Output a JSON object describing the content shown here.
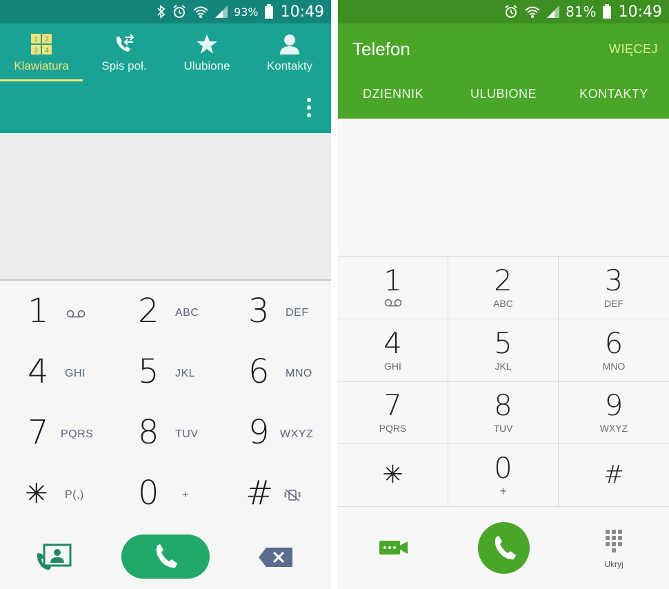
{
  "left": {
    "status": {
      "battery": "93%",
      "time": "10:49"
    },
    "tabs": [
      {
        "label": "Klawiatura",
        "icon": "keypad-grid-icon",
        "active": true
      },
      {
        "label": "Spis poł.",
        "icon": "call-log-icon"
      },
      {
        "label": "Ulubione",
        "icon": "star-icon"
      },
      {
        "label": "Kontakty",
        "icon": "person-icon"
      }
    ],
    "keys": [
      {
        "digit": "1",
        "sub": "ꝏ"
      },
      {
        "digit": "2",
        "sub": "ABC"
      },
      {
        "digit": "3",
        "sub": "DEF"
      },
      {
        "digit": "4",
        "sub": "GHI"
      },
      {
        "digit": "5",
        "sub": "JKL"
      },
      {
        "digit": "6",
        "sub": "MNO"
      },
      {
        "digit": "7",
        "sub": "PQRS"
      },
      {
        "digit": "8",
        "sub": "TUV"
      },
      {
        "digit": "9",
        "sub": "WXYZ"
      },
      {
        "digit": "✳",
        "sub": "P(,)"
      },
      {
        "digit": "0",
        "sub": "+"
      },
      {
        "digit": "#",
        "sub": ""
      }
    ],
    "colors": {
      "header": "#1aa393",
      "status": "#13857a",
      "active_tab": "#f7e27a",
      "call": "#22a86a"
    }
  },
  "right": {
    "status": {
      "battery": "81%",
      "time": "10:49"
    },
    "title": "Telefon",
    "more": "WIĘCEJ",
    "tabs": [
      "DZIENNIK",
      "ULUBIONE",
      "KONTAKTY"
    ],
    "keys": [
      {
        "digit": "1",
        "sub": "ꝏ"
      },
      {
        "digit": "2",
        "sub": "ABC"
      },
      {
        "digit": "3",
        "sub": "DEF"
      },
      {
        "digit": "4",
        "sub": "GHI"
      },
      {
        "digit": "5",
        "sub": "JKL"
      },
      {
        "digit": "6",
        "sub": "MNO"
      },
      {
        "digit": "7",
        "sub": "PQRS"
      },
      {
        "digit": "8",
        "sub": "TUV"
      },
      {
        "digit": "9",
        "sub": "WXYZ"
      },
      {
        "digit": "✳",
        "sub": ""
      },
      {
        "digit": "0",
        "sub": "+"
      },
      {
        "digit": "#",
        "sub": ""
      }
    ],
    "hide_label": "Ukryj",
    "colors": {
      "header": "#4aa628",
      "status": "#3d8f22",
      "more": "#d5f28c",
      "call": "#4aa628"
    }
  }
}
